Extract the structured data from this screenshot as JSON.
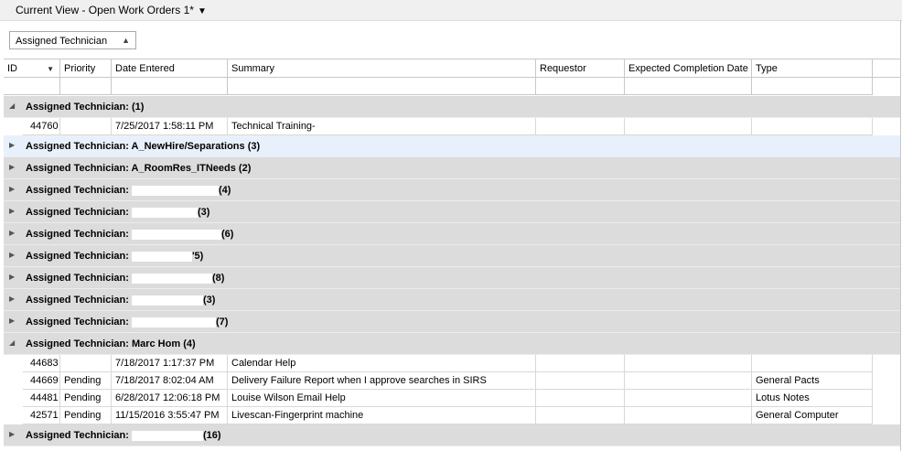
{
  "view": {
    "title": "Current View - Open Work Orders 1*",
    "caret": "▼"
  },
  "group_panel": {
    "label": "Assigned Technician",
    "sort_icon": "▲"
  },
  "columns": [
    "ID",
    "Priority",
    "Date Entered",
    "Summary",
    "Requestor",
    "Expected Completion Date",
    "Type"
  ],
  "id_filter_icon": "▼",
  "group_label": "Assigned Technician:",
  "groups": [
    {
      "name": "",
      "count": "(1)",
      "expanded": true,
      "rows": [
        {
          "id": "44760",
          "priority": "",
          "date": "7/25/2017 1:58:11 PM",
          "summary": "Technical Training-",
          "requestor": "",
          "ecd": "",
          "type": ""
        }
      ]
    },
    {
      "name": "A_NewHire/Separations",
      "count": "(3)",
      "expanded": false,
      "highlight": true
    },
    {
      "name": "A_RoomRes_ITNeeds",
      "count": "(2)",
      "expanded": false
    },
    {
      "name": "",
      "count": "(4)",
      "expanded": false
    },
    {
      "name": "",
      "count": "(3)",
      "expanded": false
    },
    {
      "name": "",
      "count": "(6)",
      "expanded": false
    },
    {
      "name": "",
      "count": "'5)",
      "expanded": false
    },
    {
      "name": "",
      "count": "(8)",
      "expanded": false
    },
    {
      "name": "",
      "count": "(3)",
      "expanded": false
    },
    {
      "name": "",
      "count": "(7)",
      "expanded": false
    },
    {
      "name": "Marc Hom",
      "count": "(4)",
      "expanded": true,
      "rows": [
        {
          "id": "44683",
          "priority": "",
          "date": "7/18/2017 1:17:37 PM",
          "summary": "Calendar Help",
          "requestor": "",
          "ecd": "",
          "type": ""
        },
        {
          "id": "44669",
          "priority": "Pending",
          "date": "7/18/2017 8:02:04 AM",
          "summary": "Delivery Failure Report when I approve searches in SIRS",
          "requestor": "",
          "ecd": "",
          "type": "General Pacts"
        },
        {
          "id": "44481",
          "priority": "Pending",
          "date": "6/28/2017 12:06:18 PM",
          "summary": "Louise Wilson Email Help",
          "requestor": "",
          "ecd": "",
          "type": "Lotus Notes"
        },
        {
          "id": "42571",
          "priority": "Pending",
          "date": "11/15/2016 3:55:47 PM",
          "summary": "Livescan-Fingerprint machine",
          "requestor": "",
          "ecd": "",
          "type": "General Computer"
        }
      ]
    },
    {
      "name": "",
      "count": "(16)",
      "expanded": false
    }
  ]
}
